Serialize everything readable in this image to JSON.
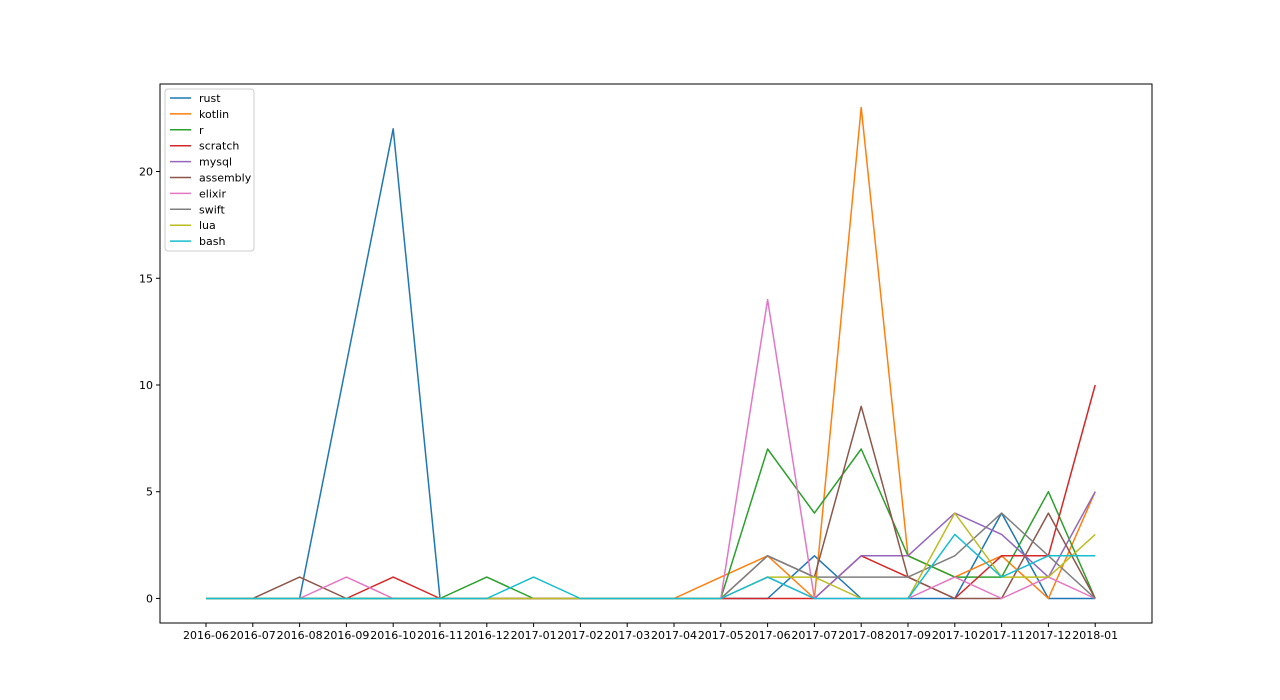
{
  "chart_data": {
    "type": "line",
    "title": "",
    "xlabel": "",
    "ylabel": "",
    "categories": [
      "2016-06",
      "2016-07",
      "2016-08",
      "2016-09",
      "2016-10",
      "2016-11",
      "2016-12",
      "2017-01",
      "2017-02",
      "2017-03",
      "2017-04",
      "2017-05",
      "2017-06",
      "2017-07",
      "2017-08",
      "2017-09",
      "2017-10",
      "2017-11",
      "2017-12",
      "2018-01"
    ],
    "ylim": [
      -1.15,
      24.1
    ],
    "yticks": [
      0,
      5,
      10,
      15,
      20
    ],
    "grid": false,
    "legend_position": "top-left",
    "series": [
      {
        "name": "rust",
        "color": "#1f77b4",
        "values": [
          0,
          0,
          0,
          11,
          22,
          0,
          0,
          0,
          0,
          0,
          0,
          0,
          0,
          2,
          0,
          0,
          0,
          4,
          0,
          0
        ]
      },
      {
        "name": "kotlin",
        "color": "#ff7f0e",
        "values": [
          0,
          0,
          0,
          0,
          0,
          0,
          0,
          0,
          0,
          0,
          0,
          1,
          2,
          0,
          23,
          2,
          1,
          2,
          0,
          5
        ]
      },
      {
        "name": "r",
        "color": "#2ca02c",
        "values": [
          0,
          0,
          0,
          0,
          0,
          0,
          1,
          0,
          0,
          0,
          0,
          0,
          7,
          4,
          7,
          2,
          1,
          1,
          5,
          0
        ]
      },
      {
        "name": "scratch",
        "color": "#d62728",
        "values": [
          0,
          0,
          0,
          0,
          1,
          0,
          0,
          0,
          0,
          0,
          0,
          0,
          0,
          0,
          2,
          1,
          0,
          2,
          2,
          10
        ]
      },
      {
        "name": "mysql",
        "color": "#9467bd",
        "values": [
          0,
          0,
          0,
          0,
          0,
          0,
          0,
          0,
          0,
          0,
          0,
          0,
          1,
          0,
          2,
          2,
          4,
          3,
          1,
          5
        ]
      },
      {
        "name": "assembly",
        "color": "#8c564b",
        "values": [
          0,
          0,
          1,
          0,
          0,
          0,
          0,
          0,
          0,
          0,
          0,
          0,
          2,
          1,
          9,
          1,
          0,
          0,
          4,
          0
        ]
      },
      {
        "name": "elixir",
        "color": "#e377c2",
        "values": [
          0,
          0,
          0,
          1,
          0,
          0,
          0,
          0,
          0,
          0,
          0,
          0,
          14,
          0,
          0,
          0,
          1,
          0,
          1,
          0
        ]
      },
      {
        "name": "swift",
        "color": "#7f7f7f",
        "values": [
          0,
          0,
          0,
          0,
          0,
          0,
          0,
          0,
          0,
          0,
          0,
          0,
          2,
          1,
          1,
          1,
          2,
          4,
          2,
          0
        ]
      },
      {
        "name": "lua",
        "color": "#bcbd22",
        "values": [
          0,
          0,
          0,
          0,
          0,
          0,
          0,
          0,
          0,
          0,
          0,
          0,
          1,
          1,
          0,
          0,
          4,
          1,
          1,
          3
        ]
      },
      {
        "name": "bash",
        "color": "#17becf",
        "values": [
          0,
          0,
          0,
          0,
          0,
          0,
          0,
          1,
          0,
          0,
          0,
          0,
          1,
          0,
          0,
          0,
          3,
          1,
          2,
          2
        ]
      }
    ]
  }
}
